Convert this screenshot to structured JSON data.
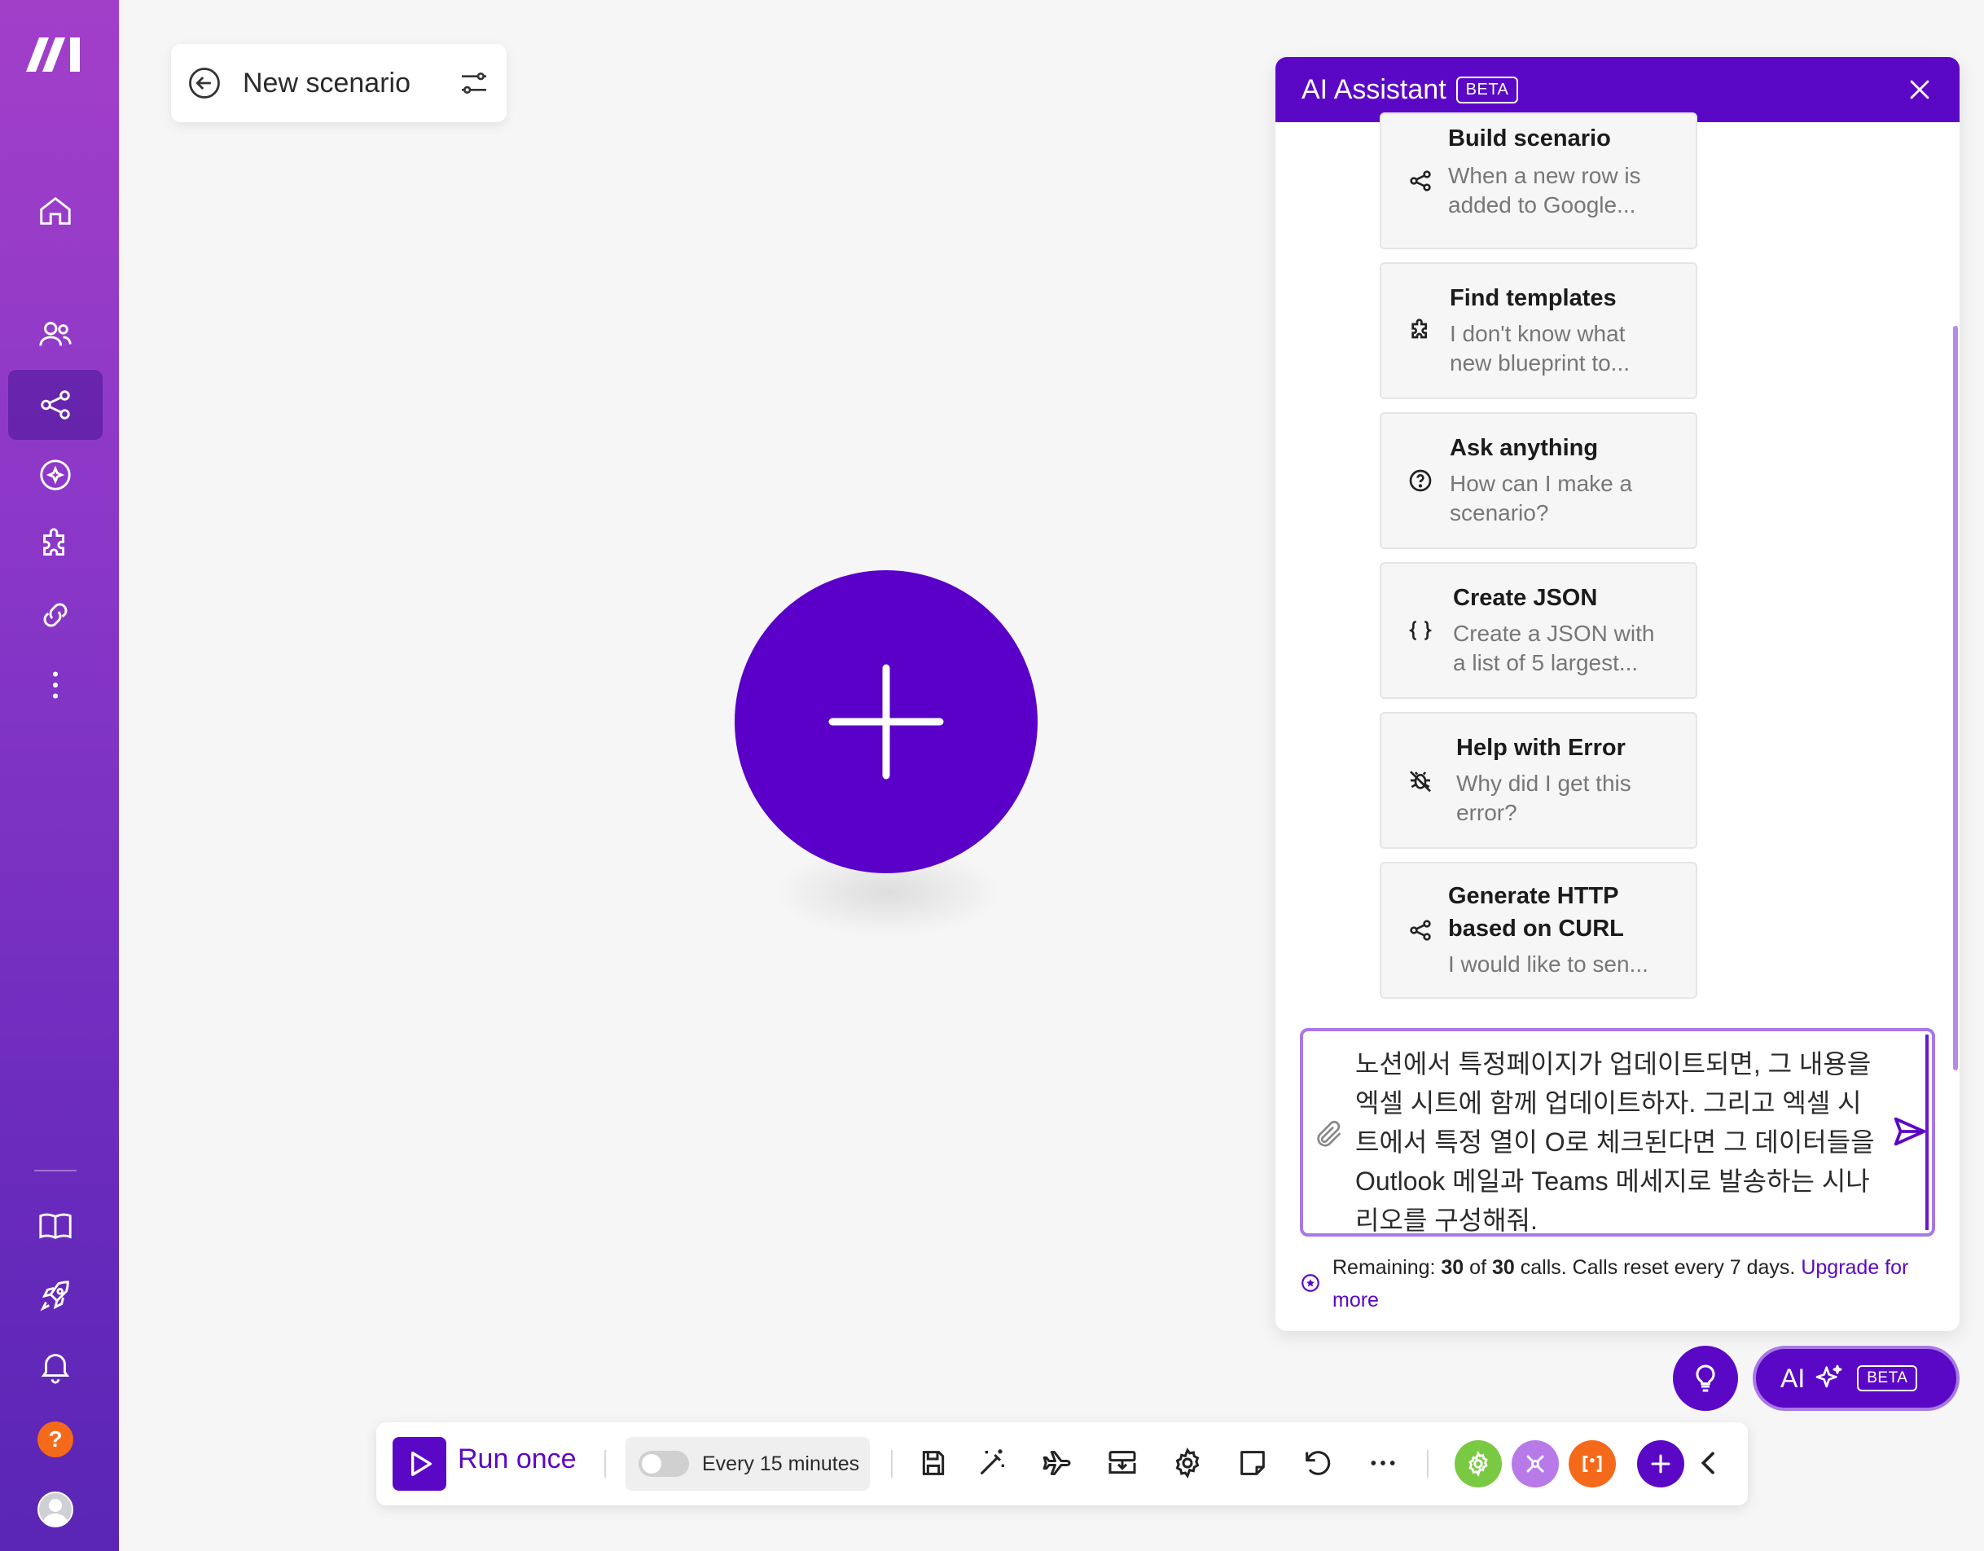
{
  "scenario": {
    "title": "New scenario"
  },
  "ai_panel": {
    "title": "AI Assistant",
    "beta": "BETA",
    "cards": [
      {
        "title": "Build scenario",
        "desc": "When a new row is added to Google...",
        "icon": "share-icon"
      },
      {
        "title": "Find templates",
        "desc": "I don't know what new blueprint to...",
        "icon": "puzzle-icon"
      },
      {
        "title": "Ask anything",
        "desc": "How can I make a scenario?",
        "icon": "question-icon"
      },
      {
        "title": "Create JSON",
        "desc": "Create a JSON with a list of 5 largest...",
        "icon": "braces-icon"
      },
      {
        "title": "Help with Error",
        "desc": "Why did I get this error?",
        "icon": "bug-icon"
      },
      {
        "title": "Generate HTTP based on CURL",
        "desc": "I would like to sen...",
        "icon": "share-icon"
      }
    ],
    "input_text": "노션에서 특정페이지가 업데이트되면, 그 내용을 엑셀 시트에 함께 업데이트하자. 그리고 엑셀 시트에서 특정 열이 O로 체크된다면 그 데이터들을 Outlook 메일과 Teams 메세지로 발송하는 시나리오를 구성해줘.",
    "remaining": {
      "prefix": "Remaining:",
      "used": "30",
      "of": "of",
      "total": "30",
      "suffix": "calls. Calls reset every 7 days.",
      "link": "Upgrade for more"
    }
  },
  "ai_button": {
    "label": "AI",
    "beta": "BETA"
  },
  "toolbar": {
    "run_label": "Run once",
    "schedule_label": "Every 15 minutes",
    "schedule_enabled": false
  },
  "colors": {
    "brand": "#5b08c6",
    "sidebar_top": "#a23fc9",
    "sidebar_bottom": "#5a25b5",
    "green": "#7ac943",
    "lilac": "#b87ae8",
    "orange": "#f56a1a"
  }
}
